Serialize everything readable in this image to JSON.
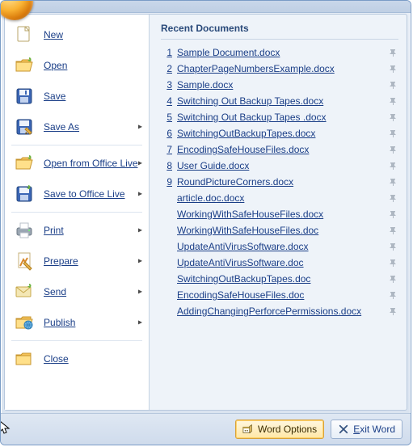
{
  "recent_header": "Recent Documents",
  "menu": [
    {
      "id": "new",
      "label": "New",
      "arrow": false
    },
    {
      "id": "open",
      "label": "Open",
      "arrow": false
    },
    {
      "id": "save",
      "label": "Save",
      "arrow": false
    },
    {
      "id": "saveas",
      "label": "Save As",
      "arrow": true
    },
    {
      "id": "-sep1"
    },
    {
      "id": "ofopen",
      "label": "Open from Office Live",
      "arrow": true
    },
    {
      "id": "ofsave",
      "label": "Save to Office Live",
      "arrow": true
    },
    {
      "id": "-sep2"
    },
    {
      "id": "print",
      "label": "Print",
      "arrow": true
    },
    {
      "id": "prepare",
      "label": "Prepare",
      "arrow": true
    },
    {
      "id": "send",
      "label": "Send",
      "arrow": true
    },
    {
      "id": "publish",
      "label": "Publish",
      "arrow": true
    },
    {
      "id": "-sep3"
    },
    {
      "id": "close",
      "label": "Close",
      "arrow": false
    }
  ],
  "recent": [
    {
      "n": "1",
      "name": "Sample Document.docx"
    },
    {
      "n": "2",
      "name": "ChapterPageNumbersExample.docx"
    },
    {
      "n": "3",
      "name": "Sample.docx"
    },
    {
      "n": "4",
      "name": "Switching Out Backup Tapes.docx"
    },
    {
      "n": "5",
      "name": "Switching Out Backup Tapes .docx"
    },
    {
      "n": "6",
      "name": "SwitchingOutBackupTapes.docx"
    },
    {
      "n": "7",
      "name": "EncodingSafeHouseFiles.docx"
    },
    {
      "n": "8",
      "name": "User Guide.docx"
    },
    {
      "n": "9",
      "name": "RoundPictureCorners.docx"
    },
    {
      "n": "",
      "name": "article.doc.docx"
    },
    {
      "n": "",
      "name": "WorkingWithSafeHouseFiles.docx"
    },
    {
      "n": "",
      "name": "WorkingWithSafeHouseFiles.doc"
    },
    {
      "n": "",
      "name": "UpdateAntiVirusSoftware.docx"
    },
    {
      "n": "",
      "name": "UpdateAntiVirusSoftware.doc"
    },
    {
      "n": "",
      "name": "SwitchingOutBackupTapes.doc"
    },
    {
      "n": "",
      "name": "EncodingSafeHouseFiles.doc"
    },
    {
      "n": "",
      "name": "AddingChangingPerforcePermissions.docx"
    }
  ],
  "footer": {
    "options": "Word Options",
    "exit": "Exit Word"
  }
}
